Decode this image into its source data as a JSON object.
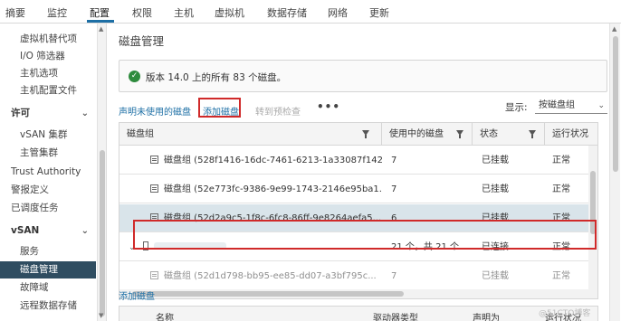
{
  "tabs": [
    {
      "label": "摘要"
    },
    {
      "label": "监控"
    },
    {
      "label": "配置",
      "active": true
    },
    {
      "label": "权限"
    },
    {
      "label": "主机"
    },
    {
      "label": "虚拟机"
    },
    {
      "label": "数据存储"
    },
    {
      "label": "网络"
    },
    {
      "label": "更新"
    }
  ],
  "sidebar": {
    "items": [
      {
        "label": "虚拟机替代项"
      },
      {
        "label": "I/O 筛选器"
      },
      {
        "label": "主机选项"
      },
      {
        "label": "主机配置文件"
      },
      {
        "label": "许可"
      },
      {
        "label": "vSAN 集群"
      },
      {
        "label": "主管集群"
      },
      {
        "label": "Trust Authority"
      },
      {
        "label": "警报定义"
      },
      {
        "label": "已调度任务"
      },
      {
        "label": "vSAN"
      },
      {
        "label": "服务"
      },
      {
        "label": "磁盘管理",
        "selected": true
      },
      {
        "label": "故障域"
      },
      {
        "label": "远程数据存储"
      }
    ]
  },
  "main": {
    "title": "磁盘管理",
    "alert": {
      "status_icon": "check-circle-icon",
      "message": "版本 14.0 上的所有 83 个磁盘。",
      "status_color": "#2e8b3d"
    },
    "actions": {
      "claim_unused": "声明未使用的磁盘",
      "add_disks": "添加磁盘",
      "precheck": "转到预检查",
      "more": "•••"
    },
    "display": {
      "label": "显示:",
      "value": "按磁盘组"
    },
    "grid": {
      "columns": [
        "磁盘组",
        "使用中的磁盘",
        "状态",
        "运行状况"
      ],
      "rows": [
        {
          "name": "磁盘组 (528f1416-16dc-7461-6213-1a33087f1427)",
          "disks": "7",
          "status": "已挂载",
          "health": "正常"
        },
        {
          "name": "磁盘组 (52e773fc-9386-9e99-1743-2146e95ba1...",
          "disks": "7",
          "status": "已挂载",
          "health": "正常"
        },
        {
          "name": "磁盘组 (52d2a9c5-1f8c-6fc8-86ff-9e8264aefa5...",
          "disks": "6",
          "status": "已挂载",
          "health": "正常",
          "selected": true
        },
        {
          "name": "",
          "disks": "21 个，共 21 个",
          "status": "已连接",
          "health": "正常",
          "host": true
        },
        {
          "name": "磁盘组 (52d1d798-bb95-ee85-dd07-a3bf795c...",
          "disks": "7",
          "status": "已挂载",
          "health": "正常"
        }
      ]
    },
    "bottom": {
      "add_disks_link": "添加磁盘",
      "columns": [
        "名称",
        "驱动器类型",
        "声明为",
        "运行状况"
      ]
    }
  },
  "watermark": "@51CTO博客",
  "accent_color": "#1d6fa5",
  "highlight_color": "#d02a2a"
}
